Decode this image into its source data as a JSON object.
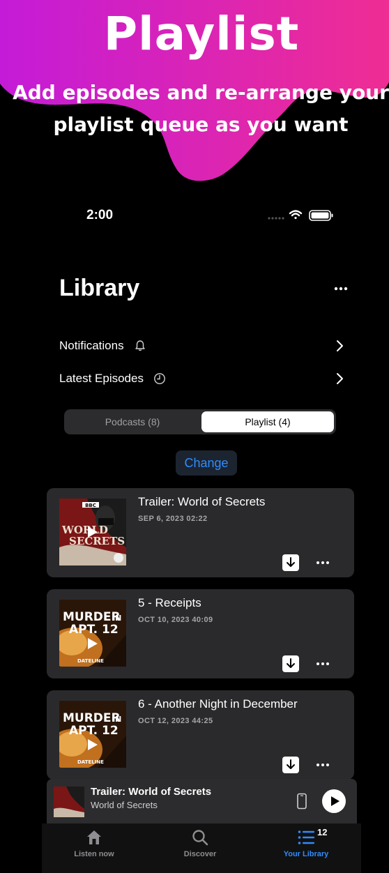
{
  "promo": {
    "title": "Playlist",
    "subtitle_line1": "Add episodes and re-arrange your",
    "subtitle_line2": "playlist queue as you want",
    "accent_colors": [
      "#c41bd8",
      "#ef2d93"
    ]
  },
  "status_bar": {
    "time": "2:00",
    "icons": [
      "signal-dots-icon",
      "wifi-icon",
      "battery-icon"
    ]
  },
  "library": {
    "title": "Library",
    "more_icon": "ellipsis-icon",
    "menu": [
      {
        "label": "Notifications",
        "icon": "bell-icon"
      },
      {
        "label": "Latest Episodes",
        "icon": "clock-icon"
      }
    ]
  },
  "segmented": {
    "options": [
      "Podcasts (8)",
      "Playlist (4)"
    ],
    "selected": "Playlist (4)"
  },
  "change_label": "Change",
  "episodes": [
    {
      "title": "Trailer: World of Secrets",
      "date": "SEP 6, 2023 02:22",
      "artwork": "world-of-secrets"
    },
    {
      "title": "5 - Receipts",
      "date": "OCT 10, 2023 40:09",
      "artwork": "murder-in-apt-12"
    },
    {
      "title": "6 - Another Night in December",
      "date": "OCT 12, 2023 44:25",
      "artwork": "murder-in-apt-12"
    }
  ],
  "artwork_text": {
    "wos_brand": "BBC",
    "wos_line1": "WORLD",
    "wos_line2": "SECRETS",
    "mur_line1": "MURDER",
    "mur_line1b": "IN",
    "mur_line2": "APT. 12",
    "mur_brand": "DATELINE"
  },
  "mini_player": {
    "title": "Trailer: World of Secrets",
    "subtitle": "World of Secrets"
  },
  "tabs": [
    {
      "label": "Listen now",
      "icon": "home-icon"
    },
    {
      "label": "Discover",
      "icon": "search-icon"
    },
    {
      "label": "Your Library",
      "icon": "list-icon",
      "badge": "12"
    }
  ],
  "colors": {
    "accent_blue": "#2f8cff",
    "card_bg": "#2a2a2c"
  }
}
